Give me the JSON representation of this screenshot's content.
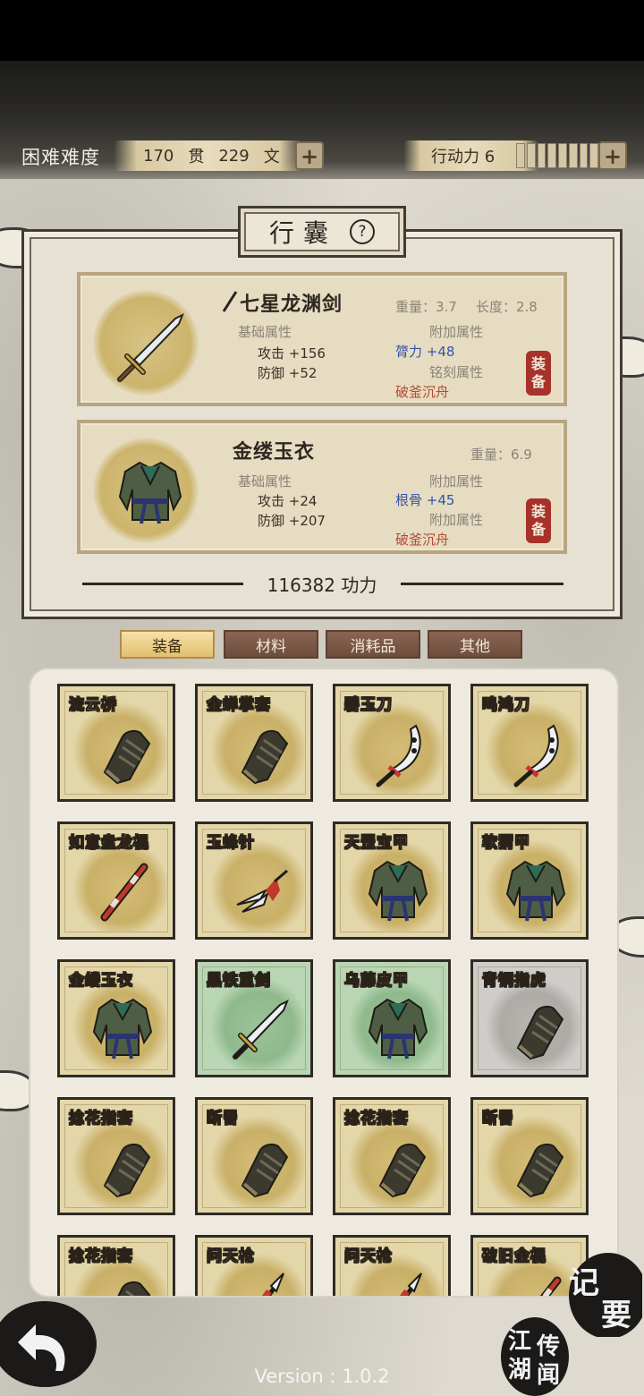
{
  "header": {
    "difficulty": "困难难度",
    "money": {
      "guan_value": "170",
      "guan_unit": "贯",
      "wen_value": "229",
      "wen_unit": "文"
    },
    "action": {
      "label": "行动力 6",
      "level": 6
    },
    "plus_symbol": "+"
  },
  "panel": {
    "title": "行囊",
    "help_symbol": "?",
    "items": [
      {
        "name": "七星龙渊剑",
        "weight": "重量：3.7",
        "length": "长度：2.8",
        "base_label": "基础属性",
        "atk": "攻击 +156",
        "def": "防御 +52",
        "extra_label": "附加属性",
        "extra_stat": "膂力 +48",
        "engrave_label": "铭刻属性",
        "engrave": "破釜沉舟",
        "equip_1": "装",
        "equip_2": "备",
        "icon": "sword-icon"
      },
      {
        "name": "金缕玉衣",
        "weight": "重量：6.9",
        "base_label": "基础属性",
        "atk": "攻击 +24",
        "def": "防御 +207",
        "extra_label": "附加属性",
        "extra_stat": "根骨 +45",
        "engrave_label": "附加属性",
        "engrave": "破釜沉舟",
        "equip_1": "装",
        "equip_2": "备",
        "icon": "armor-icon"
      }
    ],
    "power": "116382 功力"
  },
  "tabs": [
    "装备",
    "材料",
    "消耗品",
    "其他"
  ],
  "inventory": [
    {
      "name": "流云桥",
      "icon": "gauntlet-icon",
      "rarity": "gold"
    },
    {
      "name": "金蝉掌套",
      "icon": "gauntlet-icon",
      "rarity": "gold"
    },
    {
      "name": "碧玉刀",
      "icon": "saber-icon",
      "rarity": "gold"
    },
    {
      "name": "鸣鸿刀",
      "icon": "saber-icon",
      "rarity": "gold"
    },
    {
      "name": "如意盘龙棍",
      "icon": "staff-icon",
      "rarity": "gold"
    },
    {
      "name": "玉蜂针",
      "icon": "needle-icon",
      "rarity": "gold"
    },
    {
      "name": "天罡宝甲",
      "icon": "armor-icon",
      "rarity": "gold"
    },
    {
      "name": "软猬甲",
      "icon": "armor-icon",
      "rarity": "gold"
    },
    {
      "name": "金缕玉衣",
      "icon": "armor-icon",
      "rarity": "gold"
    },
    {
      "name": "黑铁重剑",
      "icon": "sword-icon",
      "rarity": "green"
    },
    {
      "name": "乌藤皮甲",
      "icon": "armor-icon",
      "rarity": "green"
    },
    {
      "name": "青铜指虎",
      "icon": "gauntlet-icon",
      "rarity": "grey"
    },
    {
      "name": "捻花指套",
      "icon": "gauntlet-icon",
      "rarity": "gold"
    },
    {
      "name": "断罾",
      "icon": "gauntlet-icon",
      "rarity": "gold"
    },
    {
      "name": "捻花指套",
      "icon": "gauntlet-icon",
      "rarity": "gold"
    },
    {
      "name": "断罾",
      "icon": "gauntlet-icon",
      "rarity": "gold"
    },
    {
      "name": "捻花指套",
      "icon": "gauntlet-icon",
      "rarity": "gold"
    },
    {
      "name": "问天枪",
      "icon": "spear-icon",
      "rarity": "gold"
    },
    {
      "name": "问天枪",
      "icon": "spear-icon",
      "rarity": "gold"
    },
    {
      "name": "破旧金棍",
      "icon": "staff-icon",
      "rarity": "gold"
    }
  ],
  "bottom": {
    "jiyao_1": "记",
    "jiyao_2": "要",
    "jianghu_1": "江",
    "jianghu_2": "湖",
    "jianghu_3": "传",
    "jianghu_4": "闻",
    "version": "Version : 1.0.2"
  },
  "colors": {
    "accent_red": "#a8312a",
    "stat_blue": "#3453a8",
    "engrave_red": "#b54a33",
    "tab_active": "#e2bf70",
    "tab_inactive": "#6c4d3d"
  }
}
